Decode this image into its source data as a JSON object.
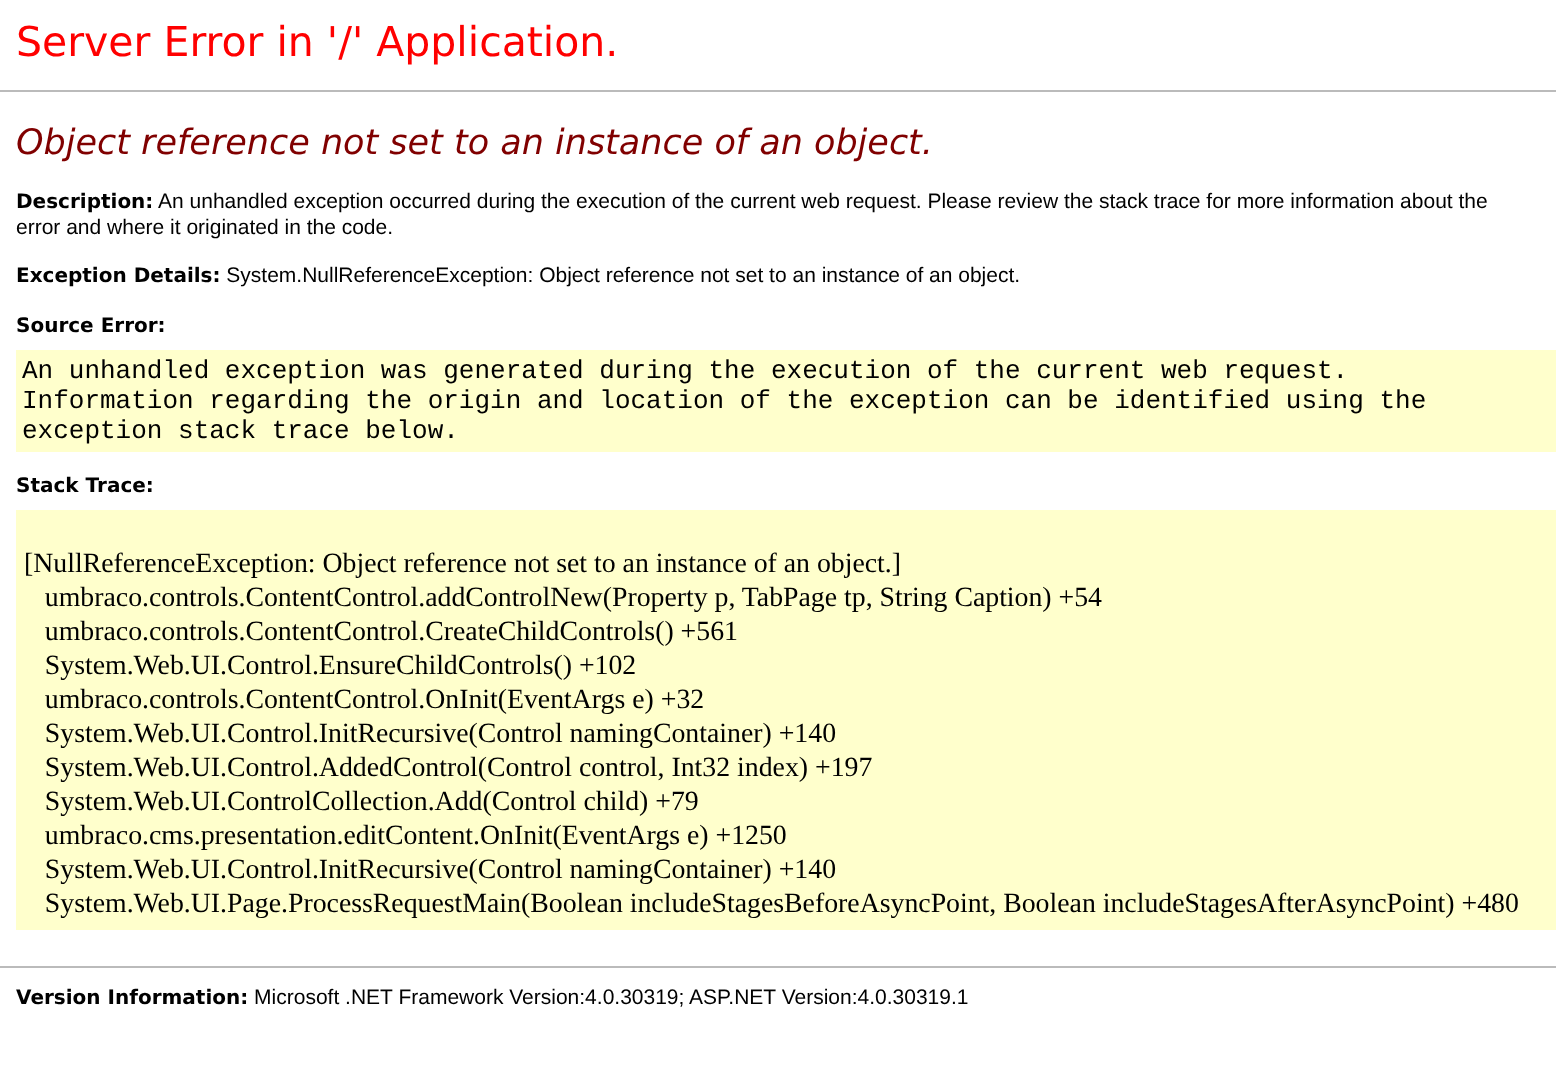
{
  "title": "Server Error in '/' Application.",
  "error_message": "Object reference not set to an instance of an object.",
  "description": {
    "label": "Description:",
    "text": "An unhandled exception occurred during the execution of the current web request. Please review the stack trace for more information about the error and where it originated in the code."
  },
  "exception_details": {
    "label": "Exception Details:",
    "text": "System.NullReferenceException: Object reference not set to an instance of an object."
  },
  "source_error": {
    "label": "Source Error:",
    "lines": [
      "An unhandled exception was generated during the execution of the current web request.",
      "Information regarding the origin and location of the exception can be identified using the",
      "exception stack trace below."
    ]
  },
  "stack_trace": {
    "label": "Stack Trace:",
    "lines": [
      "[NullReferenceException: Object reference not set to an instance of an object.]",
      "   umbraco.controls.ContentControl.addControlNew(Property p, TabPage tp, String Caption) +54",
      "   umbraco.controls.ContentControl.CreateChildControls() +561",
      "   System.Web.UI.Control.EnsureChildControls() +102",
      "   umbraco.controls.ContentControl.OnInit(EventArgs e) +32",
      "   System.Web.UI.Control.InitRecursive(Control namingContainer) +140",
      "   System.Web.UI.Control.AddedControl(Control control, Int32 index) +197",
      "   System.Web.UI.ControlCollection.Add(Control child) +79",
      "   umbraco.cms.presentation.editContent.OnInit(EventArgs e) +1250",
      "   System.Web.UI.Control.InitRecursive(Control namingContainer) +140",
      "   System.Web.UI.Page.ProcessRequestMain(Boolean includeStagesBeforeAsyncPoint, Boolean includeStagesAfterAsyncPoint) +480"
    ]
  },
  "version_information": {
    "label": "Version Information:",
    "text": "Microsoft .NET Framework Version:4.0.30319; ASP.NET Version:4.0.30319.1"
  }
}
